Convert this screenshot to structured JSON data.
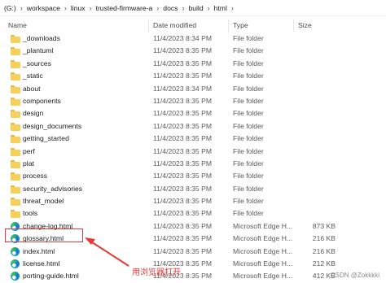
{
  "breadcrumb": {
    "items": [
      "(G:)",
      "workspace",
      "linux",
      "trusted-firmware-a",
      "docs",
      "build",
      "html"
    ],
    "separator": "›"
  },
  "columns": {
    "name": "Name",
    "date": "Date modified",
    "type": "Type",
    "size": "Size"
  },
  "files": [
    {
      "name": "_downloads",
      "date": "11/4/2023 8:34 PM",
      "type": "File folder",
      "size": "",
      "icon": "folder-icon"
    },
    {
      "name": "_plantuml",
      "date": "11/4/2023 8:35 PM",
      "type": "File folder",
      "size": "",
      "icon": "folder-icon"
    },
    {
      "name": "_sources",
      "date": "11/4/2023 8:35 PM",
      "type": "File folder",
      "size": "",
      "icon": "folder-icon"
    },
    {
      "name": "_static",
      "date": "11/4/2023 8:35 PM",
      "type": "File folder",
      "size": "",
      "icon": "folder-icon"
    },
    {
      "name": "about",
      "date": "11/4/2023 8:34 PM",
      "type": "File folder",
      "size": "",
      "icon": "folder-icon"
    },
    {
      "name": "components",
      "date": "11/4/2023 8:35 PM",
      "type": "File folder",
      "size": "",
      "icon": "folder-icon"
    },
    {
      "name": "design",
      "date": "11/4/2023 8:35 PM",
      "type": "File folder",
      "size": "",
      "icon": "folder-icon"
    },
    {
      "name": "design_documents",
      "date": "11/4/2023 8:35 PM",
      "type": "File folder",
      "size": "",
      "icon": "folder-icon"
    },
    {
      "name": "getting_started",
      "date": "11/4/2023 8:35 PM",
      "type": "File folder",
      "size": "",
      "icon": "folder-icon"
    },
    {
      "name": "perf",
      "date": "11/4/2023 8:35 PM",
      "type": "File folder",
      "size": "",
      "icon": "folder-icon"
    },
    {
      "name": "plat",
      "date": "11/4/2023 8:35 PM",
      "type": "File folder",
      "size": "",
      "icon": "folder-icon"
    },
    {
      "name": "process",
      "date": "11/4/2023 8:35 PM",
      "type": "File folder",
      "size": "",
      "icon": "folder-icon"
    },
    {
      "name": "security_advisories",
      "date": "11/4/2023 8:35 PM",
      "type": "File folder",
      "size": "",
      "icon": "folder-icon"
    },
    {
      "name": "threat_model",
      "date": "11/4/2023 8:35 PM",
      "type": "File folder",
      "size": "",
      "icon": "folder-icon"
    },
    {
      "name": "tools",
      "date": "11/4/2023 8:35 PM",
      "type": "File folder",
      "size": "",
      "icon": "folder-icon"
    },
    {
      "name": "change-log.html",
      "date": "11/4/2023 8:35 PM",
      "type": "Microsoft Edge H...",
      "size": "873 KB",
      "icon": "edge-icon"
    },
    {
      "name": "glossary.html",
      "date": "11/4/2023 8:35 PM",
      "type": "Microsoft Edge H...",
      "size": "216 KB",
      "icon": "edge-icon"
    },
    {
      "name": "index.html",
      "date": "11/4/2023 8:35 PM",
      "type": "Microsoft Edge H...",
      "size": "216 KB",
      "icon": "edge-icon"
    },
    {
      "name": "license.html",
      "date": "11/4/2023 8:35 PM",
      "type": "Microsoft Edge H...",
      "size": "212 KB",
      "icon": "edge-icon"
    },
    {
      "name": "porting-guide.html",
      "date": "11/4/2023 8:35 PM",
      "type": "Microsoft Edge H...",
      "size": "412 KB",
      "icon": "edge-icon"
    }
  ],
  "annotation": {
    "text": "用浏览器打开",
    "color": "#e53935"
  },
  "watermark": "CSDN @Zokkkki",
  "colors": {
    "folder": "#f7cf5b",
    "highlight": "#e53935"
  }
}
